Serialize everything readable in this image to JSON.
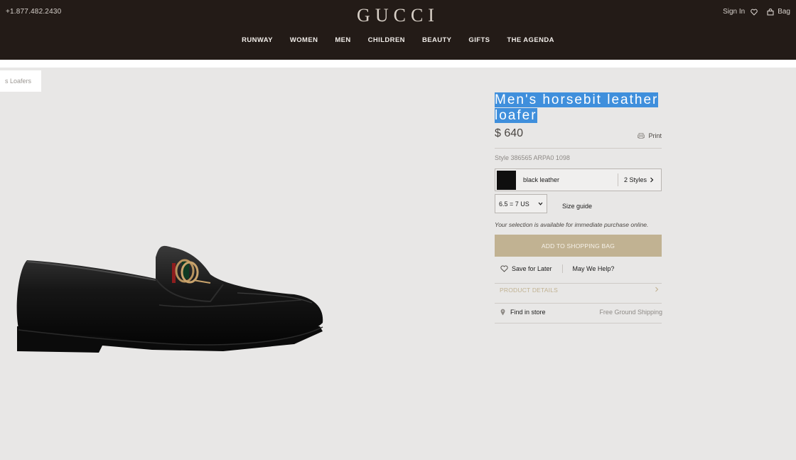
{
  "header": {
    "phone": "+1.877.482.2430",
    "logo": "GUCCI",
    "nav": [
      "RUNWAY",
      "WOMEN",
      "MEN",
      "CHILDREN",
      "BEAUTY",
      "GIFTS",
      "THE AGENDA"
    ],
    "sign_in": "Sign In",
    "bag": "Bag"
  },
  "breadcrumb": "s Loafers",
  "product": {
    "title_line1": "Men's horsebit leather",
    "title_line2": "loafer",
    "price": "$ 640",
    "print_label": "Print",
    "style_number": "Style 386565 ARPA0 1098",
    "color": "black leather",
    "styles_count": "2 Styles",
    "size": "6.5 = 7 US",
    "size_guide": "Size guide",
    "availability": "Your selection is available for immediate purchase online.",
    "add_to_bag": "ADD TO SHOPPING BAG",
    "save_for_later": "Save for Later",
    "help": "May We Help?",
    "product_details": "PRODUCT DETAILS",
    "find_in_store": "Find in store",
    "shipping": "Free Ground Shipping"
  },
  "colors": {
    "header_bg": "#231b17",
    "page_bg": "#e8e7e6",
    "accent_gold": "#c1b292",
    "selection_blue": "#3f8fdc"
  },
  "icons": [
    "heart-icon",
    "bag-icon",
    "printer-icon",
    "chevron-right-icon",
    "chevron-down-icon",
    "location-pin-icon"
  ]
}
